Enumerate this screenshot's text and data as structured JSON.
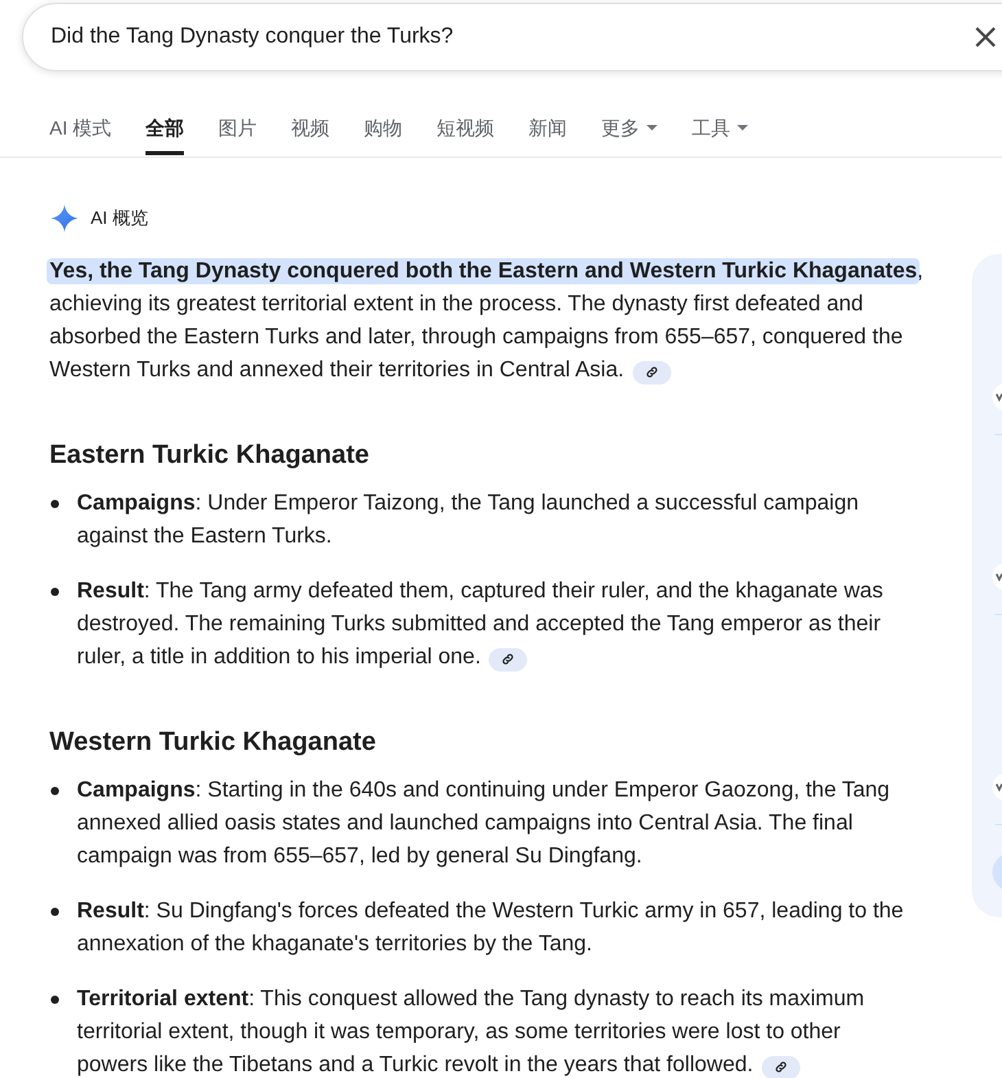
{
  "search": {
    "value": "Did the Tang Dynasty conquer the Turks?"
  },
  "tabs": [
    {
      "label": "AI 模式",
      "selected": false,
      "dropdown": false
    },
    {
      "label": "全部",
      "selected": true,
      "dropdown": false
    },
    {
      "label": "图片",
      "selected": false,
      "dropdown": false
    },
    {
      "label": "视频",
      "selected": false,
      "dropdown": false
    },
    {
      "label": "购物",
      "selected": false,
      "dropdown": false
    },
    {
      "label": "短视频",
      "selected": false,
      "dropdown": false
    },
    {
      "label": "新闻",
      "selected": false,
      "dropdown": false
    },
    {
      "label": "更多",
      "selected": false,
      "dropdown": true
    },
    {
      "label": "工具",
      "selected": false,
      "dropdown": true
    }
  ],
  "ai_overview": {
    "label": "AI 概览",
    "summary": {
      "text": "**Yes, the Tang Dynasty conquered both the Eastern and Western Turkic Khaganates**, achieving its greatest territorial extent in the process. The dynasty first defeated and absorbed the Eastern Turks and later, through campaigns from 655–657, conquered the Western Turks and annexed their territories in Central Asia.",
      "highlighted": true,
      "cited": true
    },
    "sections": [
      {
        "heading": "Eastern Turkic Khaganate",
        "points": [
          {
            "text": "**Campaigns**: Under Emperor Taizong, the Tang launched a successful campaign against the Eastern Turks.",
            "cited": false
          },
          {
            "text": "**Result**: The Tang army defeated them, captured their ruler, and the khaganate was destroyed. The remaining Turks submitted and accepted the Tang emperor as their ruler, a title in addition to his imperial one.",
            "cited": true
          }
        ]
      },
      {
        "heading": "Western Turkic Khaganate",
        "points": [
          {
            "text": "**Campaigns**: Starting in the 640s and continuing under Emperor Gaozong, the Tang annexed allied oasis states and launched campaigns into Central Asia. The final campaign was from 655–657, led by general Su Dingfang.",
            "cited": false
          },
          {
            "text": "**Result**: Su Dingfang's forces defeated the Western Turkic army in 657, leading to the annexation of the khaganate's territories by the Tang.",
            "cited": false
          },
          {
            "text": "**Territorial extent**: This conquest allowed the Tang dynasty to reach its maximum territorial extent, though it was temporary, as some territories were lost to other powers like the Tibetans and a Turkic revolt in the years that followed.",
            "cited": true
          }
        ]
      }
    ]
  }
}
